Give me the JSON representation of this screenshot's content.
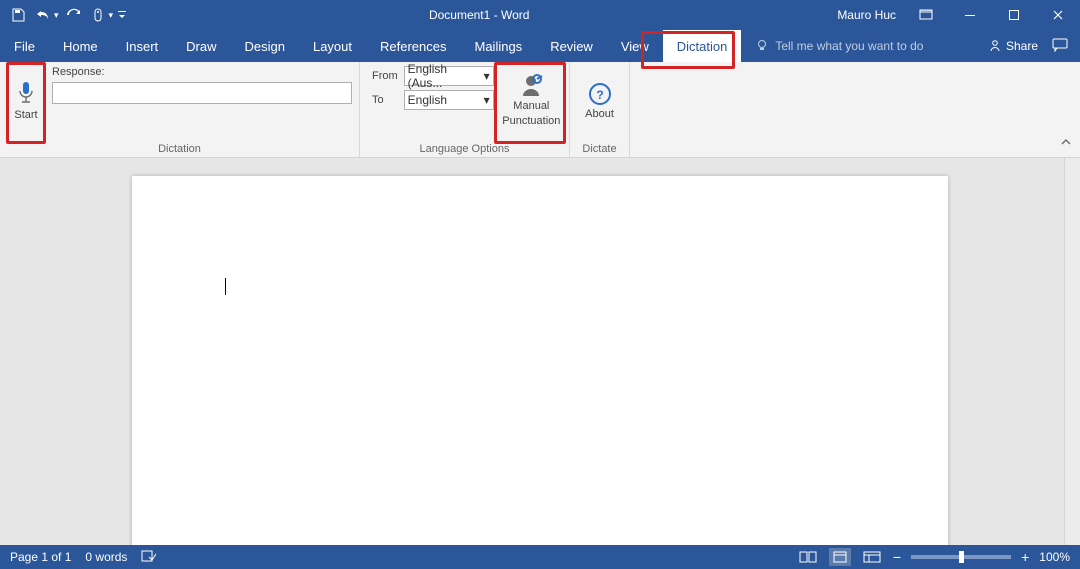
{
  "title": "Document1  -  Word",
  "user": "Mauro Huc",
  "tabs": [
    "File",
    "Home",
    "Insert",
    "Draw",
    "Design",
    "Layout",
    "References",
    "Mailings",
    "Review",
    "View",
    "Dictation"
  ],
  "active_tab": "Dictation",
  "tellme_placeholder": "Tell me what you want to do",
  "share_label": "Share",
  "ribbon": {
    "dictation": {
      "start_label": "Start",
      "response_label": "Response:",
      "group_label_dictation": "Dictation",
      "lang": {
        "from_label": "From",
        "to_label": "To",
        "from_value": "English (Aus...",
        "to_value": "English"
      },
      "group_label_lang": "Language Options",
      "manual_label1": "Manual",
      "manual_label2": "Punctuation",
      "about_label": "About",
      "group_label_dictate": "Dictate"
    }
  },
  "status": {
    "page": "Page 1 of 1",
    "words": "0 words",
    "zoom": "100%"
  }
}
